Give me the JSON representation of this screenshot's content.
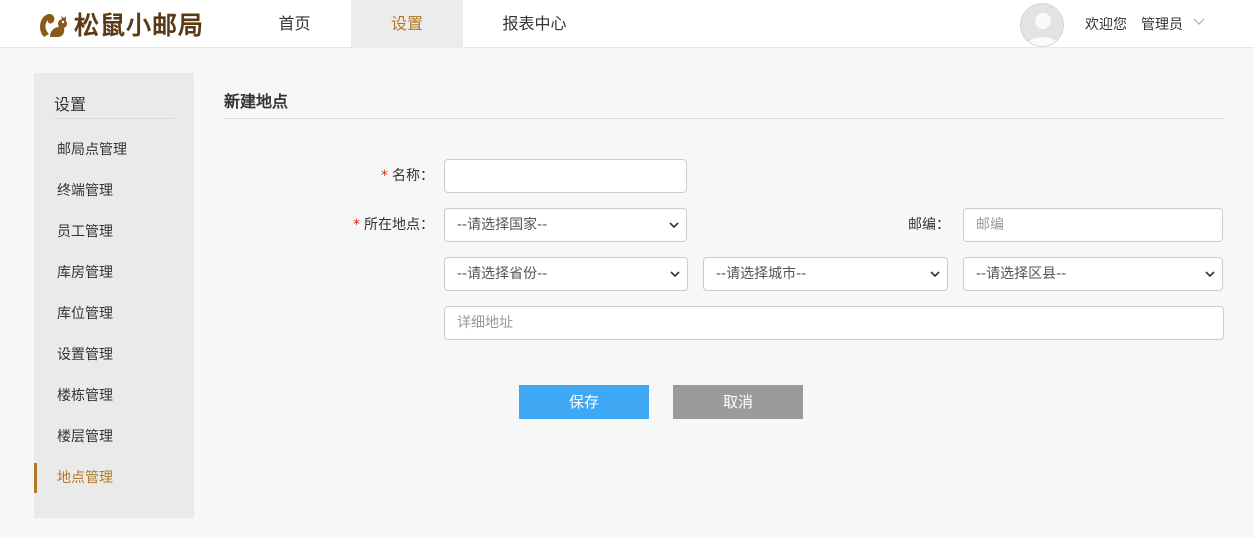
{
  "header": {
    "logo_text": "松鼠小邮局",
    "nav": [
      {
        "label": "首页"
      },
      {
        "label": "设置"
      },
      {
        "label": "报表中心"
      }
    ],
    "welcome": "欢迎您",
    "username": "管理员"
  },
  "sidebar": {
    "title": "设置",
    "items": [
      {
        "label": "邮局点管理"
      },
      {
        "label": "终端管理"
      },
      {
        "label": "员工管理"
      },
      {
        "label": "库房管理"
      },
      {
        "label": "库位管理"
      },
      {
        "label": "设置管理"
      },
      {
        "label": "楼栋管理"
      },
      {
        "label": "楼层管理"
      },
      {
        "label": "地点管理"
      }
    ]
  },
  "main": {
    "title": "新建地点",
    "form": {
      "required_mark": "*",
      "name_label": "名称：",
      "name_value": "",
      "location_label": "所在地点：",
      "country_option": "--请选择国家--",
      "postcode_label": "邮编：",
      "postcode_placeholder": "邮编",
      "province_option": "--请选择省份--",
      "city_option": "--请选择城市--",
      "district_option": "--请选择区县--",
      "address_placeholder": "详细地址"
    },
    "buttons": {
      "save": "保存",
      "cancel": "取消"
    }
  },
  "colors": {
    "accent": "#b07a2a",
    "brand": "#5b3a17",
    "save": "#3ea8f5",
    "cancel": "#9b9b9b",
    "required": "#d9251d"
  }
}
